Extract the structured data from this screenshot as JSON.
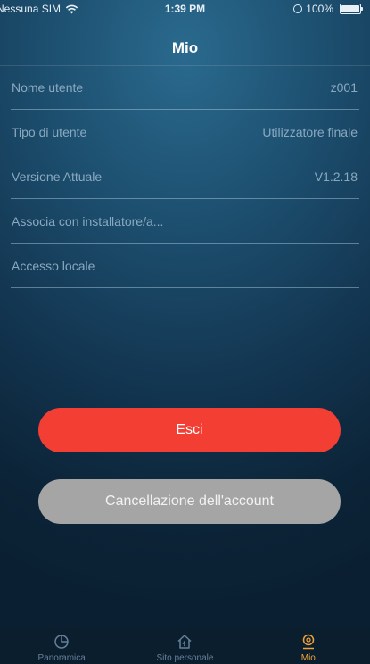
{
  "status_bar": {
    "carrier": "Nessuna SIM",
    "time": "1:39 PM",
    "battery": "100%"
  },
  "header": {
    "title": "Mio"
  },
  "settings": {
    "rows": [
      {
        "label": "Nome utente",
        "value": "z001"
      },
      {
        "label": "Tipo di utente",
        "value": "Utilizzatore finale"
      },
      {
        "label": "Versione Attuale",
        "value": "V1.2.18"
      },
      {
        "label": "Associa con installatore/a...",
        "value": ""
      },
      {
        "label": "Accesso locale",
        "value": ""
      }
    ]
  },
  "buttons": {
    "logout": "Esci",
    "delete_account": "Cancellazione dell'account"
  },
  "tab_bar": {
    "tabs": [
      {
        "label": "Panoramica",
        "icon": "pie-chart-icon",
        "active": false
      },
      {
        "label": "Sito personale",
        "icon": "home-icon",
        "active": false
      },
      {
        "label": "Mio",
        "icon": "user-icon",
        "active": true
      }
    ]
  },
  "colors": {
    "logout_button": "#f33e33",
    "delete_button": "#a5a5a5",
    "active_tab": "#f0a13a",
    "inactive_tab": "#66809a"
  }
}
